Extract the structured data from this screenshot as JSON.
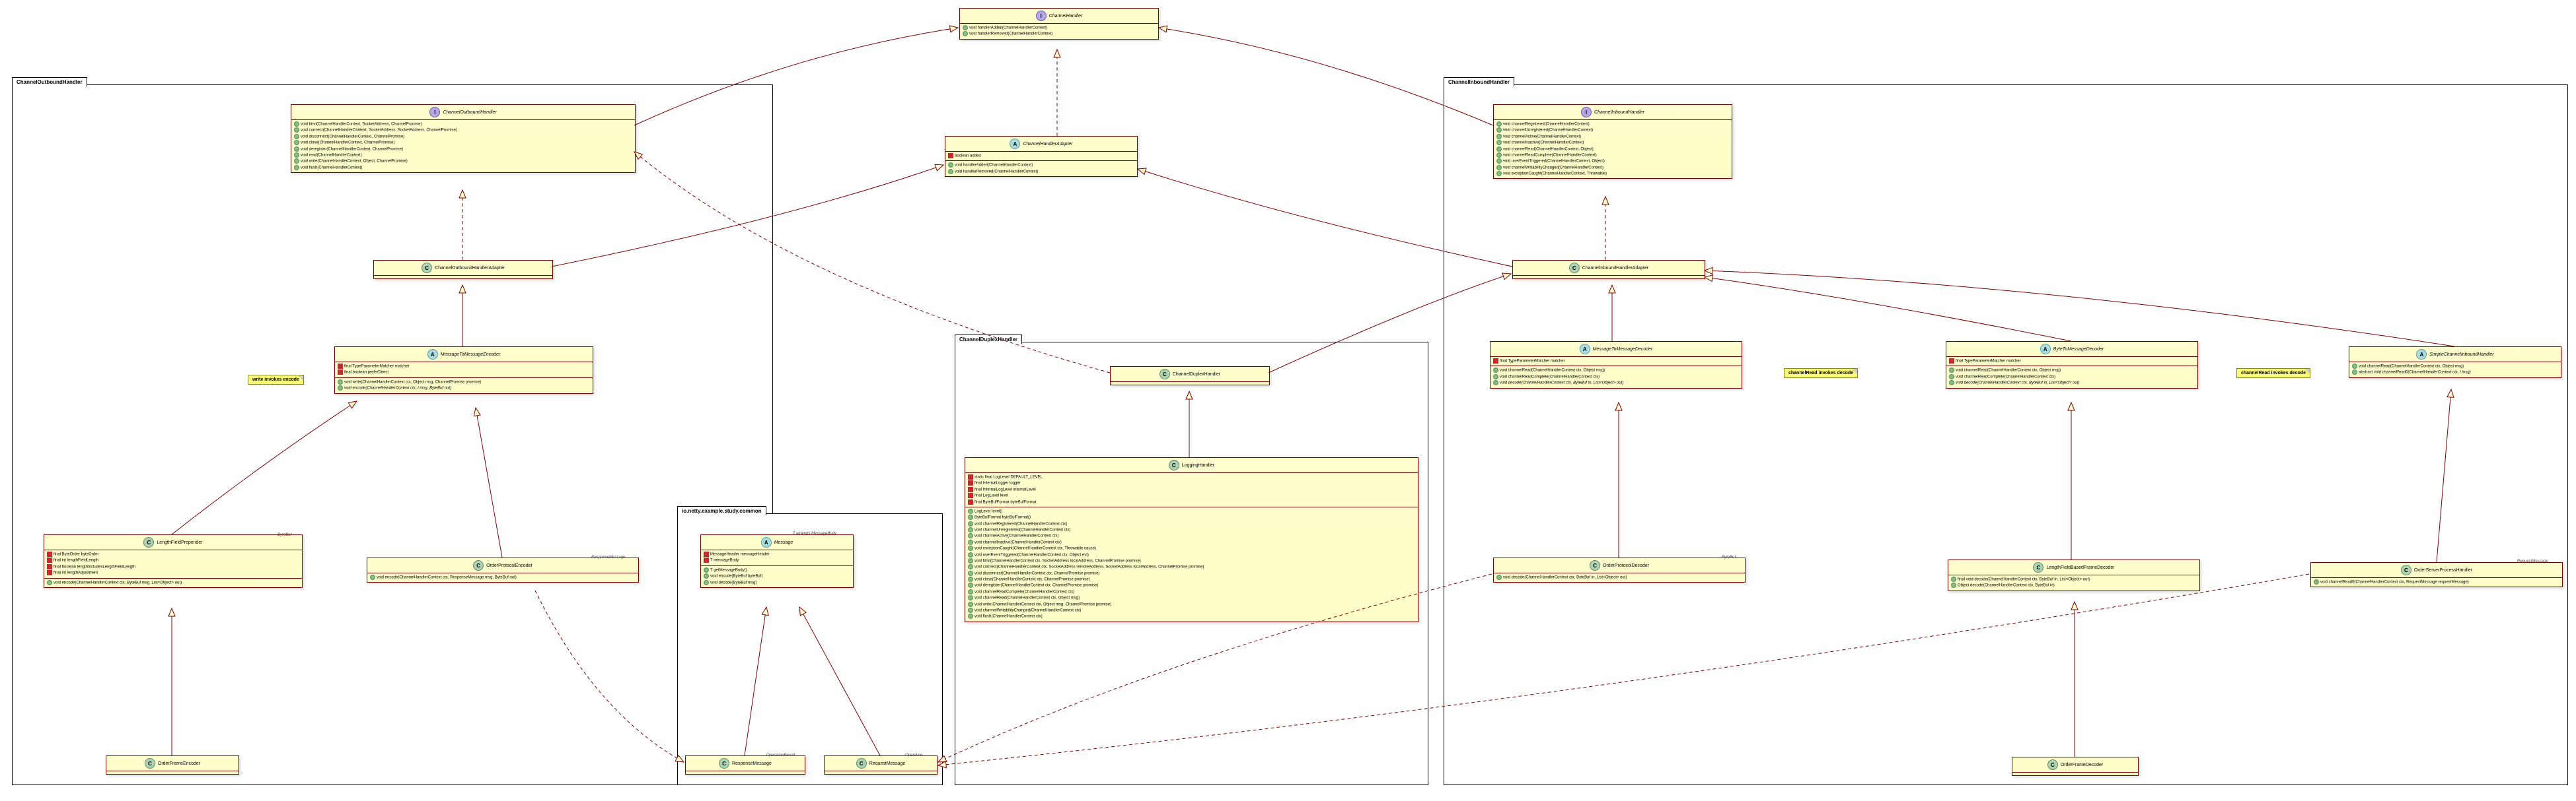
{
  "packages": {
    "outbound": {
      "title": "ChannelOutboundHandler"
    },
    "inbound": {
      "title": "ChannelInboundHandler"
    },
    "duplex": {
      "title": "ChannelDuplexHandler"
    },
    "common": {
      "title": "io.netty.example.study.common"
    }
  },
  "notes": {
    "writeEncode": {
      "text": "write invokes encode"
    },
    "readDecode1": {
      "text": "channelRead invokes decode"
    },
    "readDecode2": {
      "text": "channelRead invokes decode"
    }
  },
  "classes": {
    "ChannelHandler": {
      "name": "ChannelHandler",
      "iconLetter": "I",
      "methods": [
        "void handlerAdded(ChannelHandlerContext)",
        "void handlerRemoved(ChannelHandlerContext)"
      ]
    },
    "ChannelHandlerAdapter": {
      "name": "ChannelHandlerAdapter",
      "iconLetter": "A",
      "fields": [
        "boolean added"
      ],
      "methods": [
        "void handlerAdded(ChannelHandlerContext)",
        "void handlerRemoved(ChannelHandlerContext)"
      ]
    },
    "ChannelOutboundHandler": {
      "name": "ChannelOutboundHandler",
      "iconLetter": "I",
      "methods": [
        "void bind(ChannelHandlerContext, SocketAddress, ChannelPromise)",
        "void connect(ChannelHandlerContext, SocketAddress, SocketAddress, ChannelPromise)",
        "void disconnect(ChannelHandlerContext, ChannelPromise)",
        "void close(ChannelHandlerContext, ChannelPromise)",
        "void deregister(ChannelHandlerContext, ChannelPromise)",
        "void read(ChannelHandlerContext)",
        "void write(ChannelHandlerContext, Object, ChannelPromise)",
        "void flush(ChannelHandlerContext)"
      ]
    },
    "ChannelOutboundHandlerAdapter": {
      "name": "ChannelOutboundHandlerAdapter",
      "iconLetter": "C"
    },
    "MessageToMessageEncoder": {
      "name": "MessageToMessageEncoder",
      "iconLetter": "A",
      "fields": [
        "final TypeParameterMatcher matcher",
        "final boolean preferDirect"
      ],
      "methods": [
        "void write(ChannelHandlerContext ctx, Object msg, ChannelPromise promise)",
        "void encode(ChannelHandlerContext ctx, I msg, ByteBuf out)"
      ]
    },
    "LengthFieldPrepender": {
      "name": "LengthFieldPrepender",
      "iconLetter": "C",
      "stereotype": "ByteBuf",
      "fields": [
        "final ByteOrder byteOrder",
        "final int lengthFieldLength",
        "final boolean lengthIncludesLengthFieldLength",
        "final int lengthAdjustment"
      ],
      "methods": [
        "void encode(ChannelHandlerContext ctx, ByteBuf msg, List<Object> out)"
      ]
    },
    "OrderProtocolEncoder": {
      "name": "OrderProtocolEncoder",
      "iconLetter": "C",
      "stereotype": "ResponseMessage",
      "methods": [
        "void encode(ChannelHandlerContext ctx, ResponseMessage msg, ByteBuf out)"
      ]
    },
    "OrderFrameEncoder": {
      "name": "OrderFrameEncoder",
      "iconLetter": "C"
    },
    "Message": {
      "name": "Message",
      "iconLetter": "A",
      "stereotype": "T extends MessageBody",
      "fields": [
        "MessageHeader messageHeader",
        "T messageBody"
      ],
      "methods": [
        "T getMessageBody()",
        "void encode(ByteBuf byteBuf)",
        "void decode(ByteBuf msg)"
      ]
    },
    "ResponseMessage": {
      "name": "ResponseMessage",
      "iconLetter": "C",
      "stereotype": "OperationResult"
    },
    "RequestMessage": {
      "name": "RequestMessage",
      "iconLetter": "C",
      "stereotype": "Operation"
    },
    "ChannelDuplexHandler": {
      "name": "ChannelDuplexHandler",
      "iconLetter": "C"
    },
    "LoggingHandler": {
      "name": "LoggingHandler",
      "iconLetter": "C",
      "fields": [
        "static final LogLevel DEFAULT_LEVEL",
        "final InternalLogger logger",
        "final InternalLogLevel internalLevel",
        "final LogLevel level",
        "final ByteBufFormat byteBufFormat"
      ],
      "methods": [
        "LogLevel level()",
        "ByteBufFormat byteBufFormat()",
        "void channelRegistered(ChannelHandlerContext ctx)",
        "void channelUnregistered(ChannelHandlerContext ctx)",
        "void channelActive(ChannelHandlerContext ctx)",
        "void channelInactive(ChannelHandlerContext ctx)",
        "void exceptionCaught(ChannelHandlerContext ctx, Throwable cause)",
        "void userEventTriggered(ChannelHandlerContext ctx, Object evt)",
        "void bind(ChannelHandlerContext ctx, SocketAddress localAddress, ChannelPromise promise)",
        "void connect(ChannelHandlerContext ctx, SocketAddress remoteAddress, SocketAddress localAddress, ChannelPromise promise)",
        "void disconnect(ChannelHandlerContext ctx, ChannelPromise promise)",
        "void close(ChannelHandlerContext ctx, ChannelPromise promise)",
        "void deregister(ChannelHandlerContext ctx, ChannelPromise promise)",
        "void channelReadComplete(ChannelHandlerContext ctx)",
        "void channelRead(ChannelHandlerContext ctx, Object msg)",
        "void write(ChannelHandlerContext ctx, Object msg, ChannelPromise promise)",
        "void channelWritabilityChanged(ChannelHandlerContext ctx)",
        "void flush(ChannelHandlerContext ctx)"
      ]
    },
    "ChannelInboundHandler": {
      "name": "ChannelInboundHandler",
      "iconLetter": "I",
      "methods": [
        "void channelRegistered(ChannelHandlerContext)",
        "void channelUnregistered(ChannelHandlerContext)",
        "void channelActive(ChannelHandlerContext)",
        "void channelInactive(ChannelHandlerContext)",
        "void channelRead(ChannelHandlerContext, Object)",
        "void channelReadComplete(ChannelHandlerContext)",
        "void userEventTriggered(ChannelHandlerContext, Object)",
        "void channelWritabilityChanged(ChannelHandlerContext)",
        "void exceptionCaught(ChannelHandlerContext, Throwable)"
      ]
    },
    "ChannelInboundHandlerAdapter": {
      "name": "ChannelInboundHandlerAdapter",
      "iconLetter": "C"
    },
    "MessageToMessageDecoder": {
      "name": "MessageToMessageDecoder",
      "iconLetter": "A",
      "fields": [
        "final TypeParameterMatcher matcher"
      ],
      "methods": [
        "void channelRead(ChannelHandlerContext ctx, Object msg)",
        "void channelReadComplete(ChannelHandlerContext ctx)",
        "void decode(ChannelHandlerContext ctx, ByteBuf in, List<Object> out)"
      ]
    },
    "ByteToMessageDecoder": {
      "name": "ByteToMessageDecoder",
      "iconLetter": "A",
      "fields": [
        "final TypeParameterMatcher matcher"
      ],
      "methods": [
        "void channelRead(ChannelHandlerContext ctx, Object msg)",
        "void channelReadComplete(ChannelHandlerContext ctx)",
        "void decode(ChannelHandlerContext ctx, ByteBuf in, List<Object> out)"
      ]
    },
    "SimpleChannelInboundHandler": {
      "name": "SimpleChannelInboundHandler",
      "iconLetter": "A",
      "methods": [
        "void channelRead(ChannelHandlerContext ctx, Object msg)",
        "abstract void channelRead0(ChannelHandlerContext ctx, I msg)"
      ]
    },
    "OrderProtocolDecoder": {
      "name": "OrderProtocolDecoder",
      "iconLetter": "C",
      "stereotype": "ByteBuf",
      "methods": [
        "void decode(ChannelHandlerContext ctx, ByteBuf in, List<Object> out)"
      ]
    },
    "LengthFieldBasedFrameDecoder": {
      "name": "LengthFieldBasedFrameDecoder",
      "iconLetter": "C",
      "methods": [
        "final void decode(ChannelHandlerContext ctx, ByteBuf in, List<Object> out)",
        "Object decode(ChannelHandlerContext ctx, ByteBuf in)"
      ]
    },
    "OrderServerProcessHandler": {
      "name": "OrderServerProcessHandler",
      "iconLetter": "C",
      "stereotype": "RequestMessage",
      "methods": [
        "void channelRead0(ChannelHandlerContext ctx, RequestMessage requestMessage)"
      ]
    },
    "OrderFrameDecoder": {
      "name": "OrderFrameDecoder",
      "iconLetter": "C"
    }
  }
}
